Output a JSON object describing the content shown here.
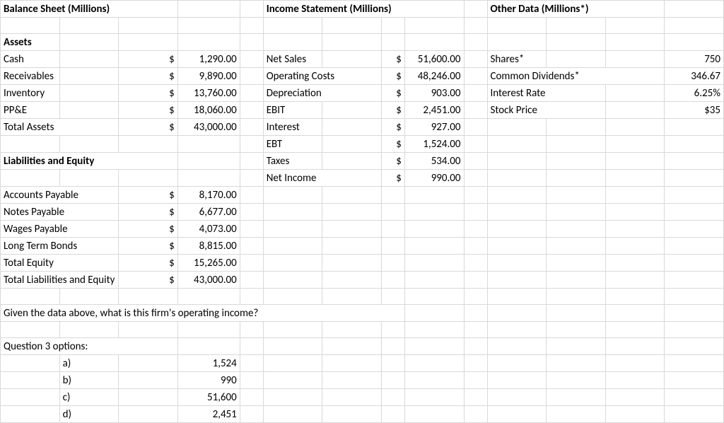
{
  "headers": {
    "balanceSheet": "Balance Sheet (Millions)",
    "incomeStatement": "Income Statement (Millions)",
    "otherData": "Other Data (Millions*)"
  },
  "assetsHeader": "Assets",
  "assets": {
    "cash": {
      "label": "Cash",
      "sym": "$",
      "val": "1,290.00"
    },
    "receivables": {
      "label": "Receivables",
      "sym": "$",
      "val": "9,890.00"
    },
    "inventory": {
      "label": "Inventory",
      "sym": "$",
      "val": "13,760.00"
    },
    "ppe": {
      "label": "PP&E",
      "sym": "$",
      "val": "18,060.00"
    },
    "total": {
      "label": "Total Assets",
      "sym": "$",
      "val": "43,000.00"
    }
  },
  "liabHeader": "Liabilities and Equity",
  "liab": {
    "ap": {
      "label": "Accounts Payable",
      "sym": "$",
      "val": "8,170.00"
    },
    "np": {
      "label": "Notes Payable",
      "sym": "$",
      "val": "6,677.00"
    },
    "wp": {
      "label": "Wages Payable",
      "sym": "$",
      "val": "4,073.00"
    },
    "ltb": {
      "label": "Long Term Bonds",
      "sym": "$",
      "val": "8,815.00"
    },
    "te": {
      "label": "Total Equity",
      "sym": "$",
      "val": "15,265.00"
    },
    "tle": {
      "label": "Total Liabilities and Equity",
      "sym": "$",
      "val": "43,000.00"
    }
  },
  "income": {
    "netSales": {
      "label": "Net Sales",
      "sym": "$",
      "val": "51,600.00"
    },
    "opCosts": {
      "label": "Operating Costs",
      "sym": "$",
      "val": "48,246.00"
    },
    "depr": {
      "label": "Depreciation",
      "sym": "$",
      "val": "903.00"
    },
    "ebit": {
      "label": "EBIT",
      "sym": "$",
      "val": "2,451.00"
    },
    "interest": {
      "label": "Interest",
      "sym": "$",
      "val": "927.00"
    },
    "ebt": {
      "label": "EBT",
      "sym": "$",
      "val": "1,524.00"
    },
    "taxes": {
      "label": "Taxes",
      "sym": "$",
      "val": "534.00"
    },
    "netInc": {
      "label": "Net Income",
      "sym": "$",
      "val": "990.00"
    }
  },
  "other": {
    "shares": {
      "label": "Shares*",
      "val": "750"
    },
    "div": {
      "label": "Common Dividends*",
      "val": "346.67"
    },
    "ir": {
      "label": "Interest Rate",
      "val": "6.25%"
    },
    "sp": {
      "label": "Stock Price",
      "val": "$35"
    }
  },
  "question": "Given the data above, what is this firm's operating income?",
  "optionsHeader": "Question 3 options:",
  "options": {
    "a": {
      "label": "a)",
      "val": "1,524"
    },
    "b": {
      "label": "b)",
      "val": "990"
    },
    "c": {
      "label": "c)",
      "val": "51,600"
    },
    "d": {
      "label": "d)",
      "val": "2,451"
    }
  },
  "chart_data": {
    "type": "table",
    "title": "Financial Data and Question",
    "balance_sheet": {
      "assets": [
        {
          "item": "Cash",
          "value": 1290.0
        },
        {
          "item": "Receivables",
          "value": 9890.0
        },
        {
          "item": "Inventory",
          "value": 13760.0
        },
        {
          "item": "PP&E",
          "value": 18060.0
        },
        {
          "item": "Total Assets",
          "value": 43000.0
        }
      ],
      "liabilities_and_equity": [
        {
          "item": "Accounts Payable",
          "value": 8170.0
        },
        {
          "item": "Notes Payable",
          "value": 6677.0
        },
        {
          "item": "Wages Payable",
          "value": 4073.0
        },
        {
          "item": "Long Term Bonds",
          "value": 8815.0
        },
        {
          "item": "Total Equity",
          "value": 15265.0
        },
        {
          "item": "Total Liabilities and Equity",
          "value": 43000.0
        }
      ]
    },
    "income_statement": [
      {
        "item": "Net Sales",
        "value": 51600.0
      },
      {
        "item": "Operating Costs",
        "value": 48246.0
      },
      {
        "item": "Depreciation",
        "value": 903.0
      },
      {
        "item": "EBIT",
        "value": 2451.0
      },
      {
        "item": "Interest",
        "value": 927.0
      },
      {
        "item": "EBT",
        "value": 1524.0
      },
      {
        "item": "Taxes",
        "value": 534.0
      },
      {
        "item": "Net Income",
        "value": 990.0
      }
    ],
    "other_data": [
      {
        "item": "Shares*",
        "value": 750
      },
      {
        "item": "Common Dividends*",
        "value": 346.67
      },
      {
        "item": "Interest Rate",
        "value": "6.25%"
      },
      {
        "item": "Stock Price",
        "value": "$35"
      }
    ],
    "question": "Given the data above, what is this firm's operating income?",
    "options": [
      {
        "letter": "a",
        "value": 1524
      },
      {
        "letter": "b",
        "value": 990
      },
      {
        "letter": "c",
        "value": 51600
      },
      {
        "letter": "d",
        "value": 2451
      }
    ]
  }
}
